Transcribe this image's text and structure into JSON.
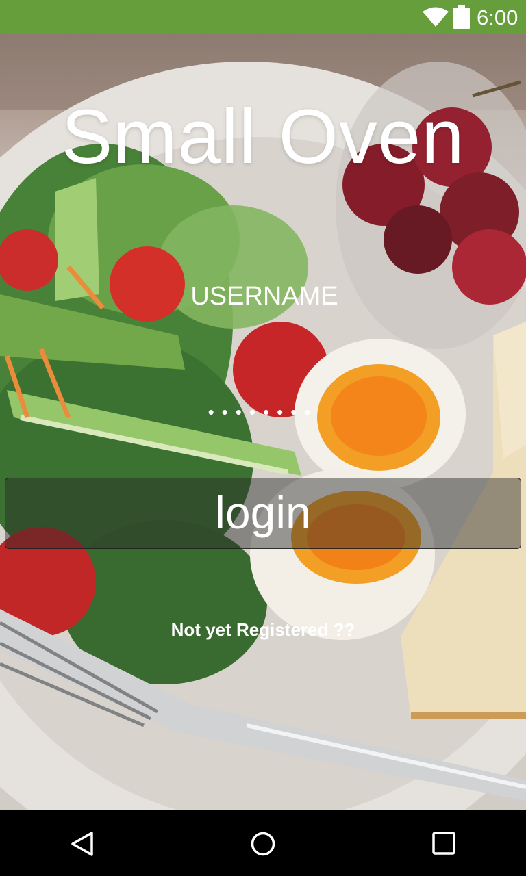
{
  "status_bar": {
    "time": "6:00",
    "background_color": "#669e3c",
    "icons": [
      "wifi-icon",
      "battery-icon"
    ]
  },
  "app": {
    "title": "Small Oven"
  },
  "login_form": {
    "username_placeholder": "USERNAME",
    "password_value": "••••••••",
    "login_label": "login",
    "register_label": "Not yet Registered ??"
  },
  "nav_bar": {
    "icons": [
      "back-icon",
      "home-icon",
      "recents-icon"
    ]
  }
}
